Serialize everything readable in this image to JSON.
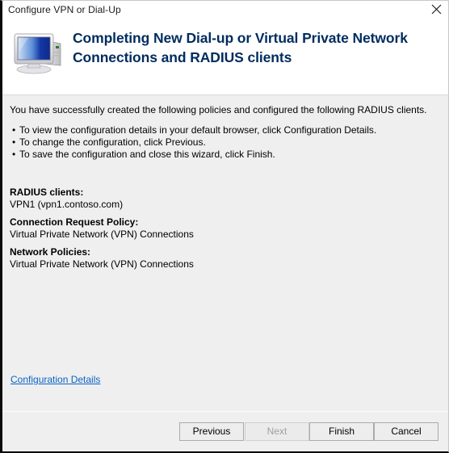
{
  "window": {
    "title": "Configure VPN or Dial-Up",
    "close_label": "×",
    "close_icon": "close-icon"
  },
  "header": {
    "icon": "computer-monitor-icon",
    "title": "Completing New Dial-up or Virtual Private Network Connections and RADIUS clients"
  },
  "body": {
    "intro": "You have successfully created the following policies and configured the following RADIUS clients.",
    "bullet_char": "•",
    "bullets": [
      "To view the configuration details in your default browser, click Configuration Details.",
      "To change the configuration, click Previous.",
      "To save the configuration and close this wizard, click Finish."
    ],
    "summary": [
      {
        "label": "RADIUS clients:",
        "value": "VPN1 (vpn1.contoso.com)"
      },
      {
        "label": "Connection Request Policy:",
        "value": "Virtual Private Network (VPN) Connections"
      },
      {
        "label": "Network Policies:",
        "value": "Virtual Private Network (VPN) Connections"
      }
    ],
    "details_link": "Configuration Details"
  },
  "footer": {
    "previous_label": "Previous",
    "next_label": "Next",
    "finish_label": "Finish",
    "cancel_label": "Cancel"
  },
  "colors": {
    "title_text": "#002c5f",
    "link": "#0b62c4",
    "body_background": "#efefef",
    "header_background": "#ffffff",
    "disabled_text": "#a0a0a0"
  }
}
